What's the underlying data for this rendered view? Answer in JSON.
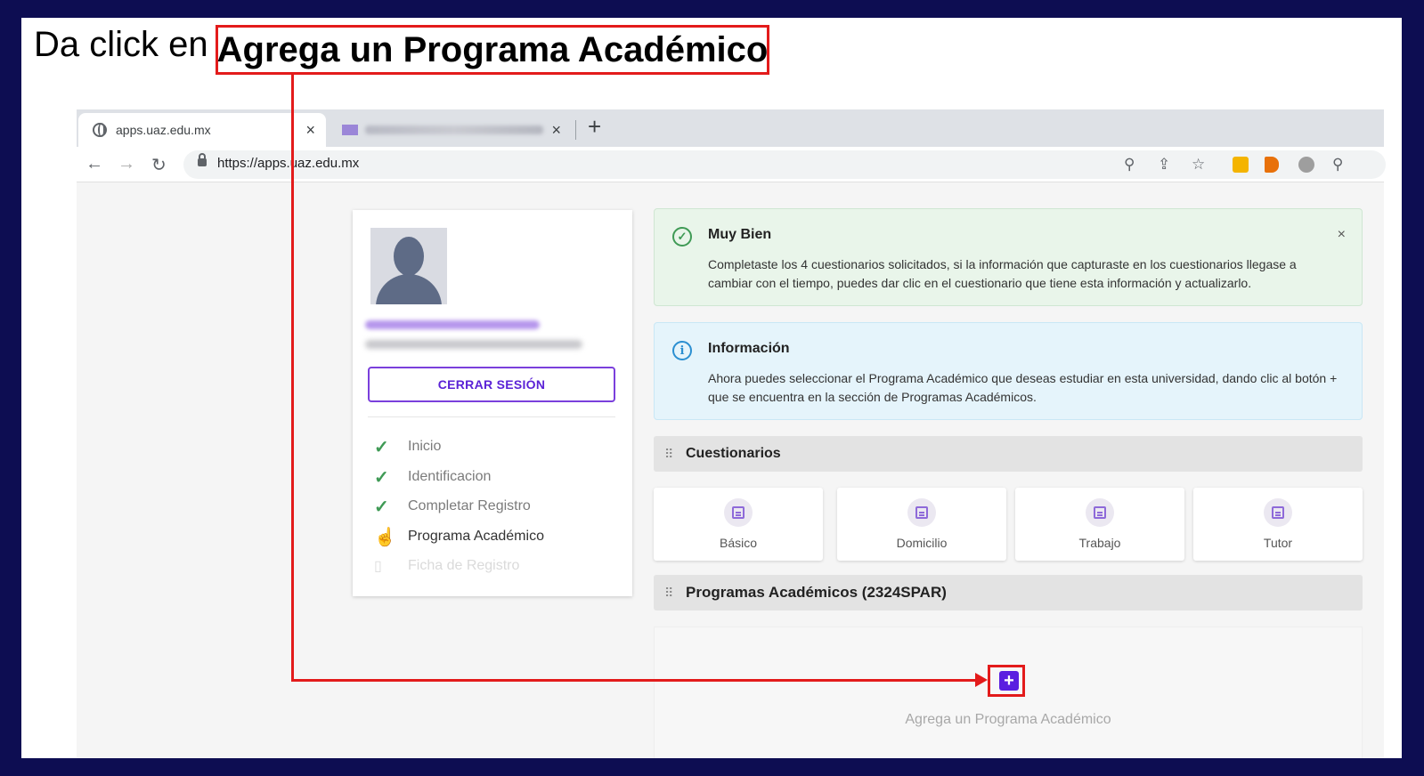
{
  "instruction": {
    "prefix": "Da click en",
    "highlight": "Agrega un Programa Académico"
  },
  "browser": {
    "tabs": [
      {
        "title": "apps.uaz.edu.mx",
        "close": "×"
      },
      {
        "title": "",
        "close": "×"
      }
    ],
    "new_tab": "+",
    "url": "https://apps.uaz.edu.mx",
    "nav": {
      "back": "←",
      "forward": "→",
      "reload": "↻"
    },
    "toolbar_icons": {
      "zoom": "⚲",
      "share": "⇪",
      "star": "☆",
      "account": "⚲"
    }
  },
  "profile": {
    "logout_label": "CERRAR SESIÓN",
    "steps": [
      {
        "label": "Inicio",
        "state": "done"
      },
      {
        "label": "Identificacion",
        "state": "done"
      },
      {
        "label": "Completar Registro",
        "state": "done"
      },
      {
        "label": "Programa Académico",
        "state": "active"
      },
      {
        "label": "Ficha de Registro",
        "state": "disabled"
      }
    ]
  },
  "alerts": {
    "success": {
      "title": "Muy Bien",
      "text": "Completaste los 4 cuestionarios solicitados, si la información que capturaste en los cuestionarios llegase a cambiar con el tiempo, puedes dar clic en el cuestionario que tiene esta información y actualizarlo.",
      "close": "×"
    },
    "info": {
      "title": "Información",
      "text": "Ahora puedes seleccionar el Programa Académico que deseas estudiar en esta universidad, dando clic al botón + que se encuentra en la sección de Programas Académicos."
    }
  },
  "questionnaires": {
    "title": "Cuestionarios",
    "items": [
      "Básico",
      "Domicilio",
      "Trabajo",
      "Tutor"
    ]
  },
  "programs": {
    "title": "Programas Académicos (2324SPAR)",
    "add_label": "Agrega un Programa Académico",
    "add_button": "+"
  },
  "colors": {
    "annotation": "#e31b1b",
    "accent": "#5a1ee0",
    "slide_border": "#0d0d52"
  }
}
